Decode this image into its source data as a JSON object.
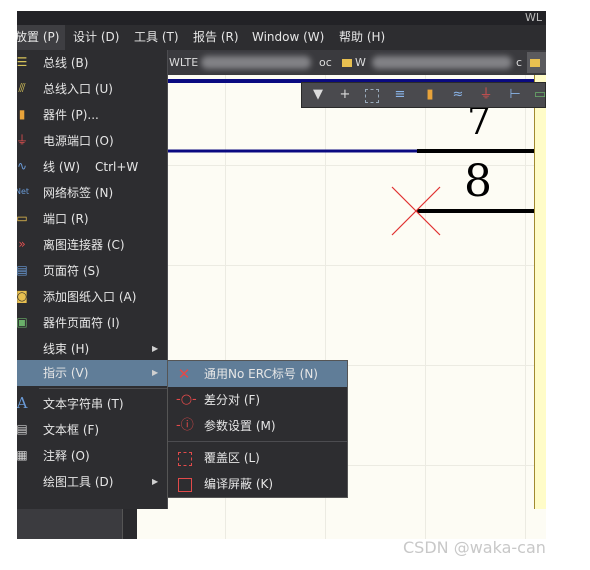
{
  "title_fragment": "WL",
  "menubar": [
    {
      "label": "放置 (P)",
      "active": true
    },
    {
      "label": "设计 (D)",
      "active": false
    },
    {
      "label": "工具 (T)",
      "active": false
    },
    {
      "label": "报告 (R)",
      "active": false
    },
    {
      "label": "Window (W)",
      "active": false
    },
    {
      "label": "帮助 (H)",
      "active": false
    }
  ],
  "tabs": [
    {
      "label": "WLTE"
    },
    {
      "label": "oc"
    },
    {
      "label": "W"
    },
    {
      "label": "c"
    }
  ],
  "place_menu": [
    {
      "label": "总线 (B)",
      "icon": "bus-icon",
      "color": "#d6c35a"
    },
    {
      "label": "总线入口 (U)",
      "icon": "bus-entry-icon",
      "color": "#d6c35a"
    },
    {
      "label": "器件 (P)...",
      "icon": "part-icon",
      "color": "#e8a33a"
    },
    {
      "label": "电源端口 (O)",
      "icon": "power-port-icon",
      "color": "#e05050"
    },
    {
      "label": "线 (W)",
      "shortcut": "Ctrl+W",
      "icon": "wire-icon",
      "color": "#6a9ad6"
    },
    {
      "label": "网络标签 (N)",
      "icon": "net-label-icon",
      "color": "#6a9ad6"
    },
    {
      "label": "端口 (R)",
      "icon": "port-icon",
      "color": "#e8c050"
    },
    {
      "label": "离图连接器 (C)",
      "icon": "off-sheet-connector-icon",
      "color": "#e05050"
    },
    {
      "label": "页面符 (S)",
      "icon": "sheet-symbol-icon",
      "color": "#6a9ad6"
    },
    {
      "label": "添加图纸入口 (A)",
      "icon": "sheet-entry-icon",
      "color": "#e8c050"
    },
    {
      "label": "器件页面符 (I)",
      "icon": "device-sheet-icon",
      "color": "#6ab06a"
    },
    {
      "label": "线束 (H)",
      "icon": "",
      "color": "",
      "submenu": true
    },
    {
      "label": "指示 (V)",
      "icon": "",
      "color": "",
      "submenu": true,
      "highlighted": true
    },
    {
      "label": "文本字符串 (T)",
      "icon": "text-string-icon",
      "color": "#6a9ad6"
    },
    {
      "label": "文本框 (F)",
      "icon": "text-frame-icon",
      "color": "#d0d0d0"
    },
    {
      "label": "注释 (O)",
      "icon": "note-icon",
      "color": "#d0d0d0"
    },
    {
      "label": "绘图工具 (D)",
      "icon": "",
      "color": "",
      "submenu": true
    }
  ],
  "directives_submenu": [
    {
      "label": "通用No ERC标号 (N)",
      "icon": "no-erc-icon",
      "highlighted": true
    },
    {
      "label": "差分对 (F)",
      "icon": "diff-pair-icon"
    },
    {
      "label": "参数设置 (M)",
      "icon": "parameter-set-icon"
    },
    {
      "label": "覆盖区 (L)",
      "icon": "blanket-icon"
    },
    {
      "label": "编译屏蔽 (K)",
      "icon": "compile-mask-icon"
    }
  ],
  "toolbar_icons": [
    "filter-icon",
    "crosshair-icon",
    "select-rect-icon",
    "align-icon",
    "part-icon",
    "bus-icon",
    "power-icon",
    "net-label-icon",
    "port-icon"
  ],
  "schematic": {
    "pin_numbers": [
      "7",
      "8"
    ],
    "no_erc_color": "#e03030",
    "wire_color": "#0a0a80"
  },
  "watermark": "CSDN @waka-can",
  "colors": {
    "menu_bg": "#2d2d30",
    "highlight": "#607d98",
    "canvas_bg": "#fdfcf4"
  }
}
